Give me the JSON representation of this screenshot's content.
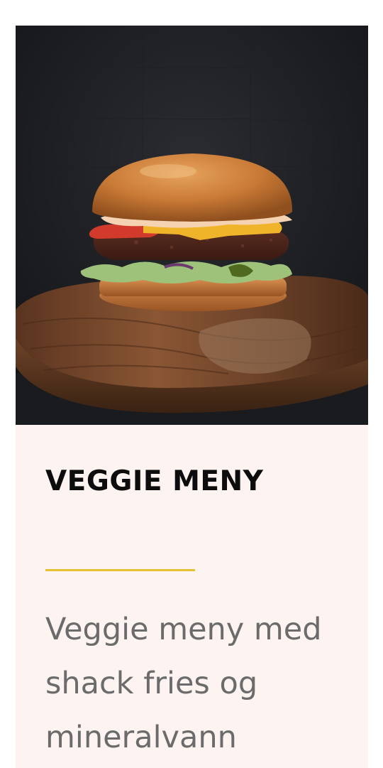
{
  "card": {
    "image": {
      "subject": "burger-photo"
    },
    "title": "VEGGIE MENY",
    "description": "Veggie meny med shack fries og mineralvann"
  },
  "colors": {
    "card_background": "#fdf3f1",
    "accent_divider": "#e8c131",
    "title": "#0d0d0d",
    "description": "#6b6b6b"
  }
}
